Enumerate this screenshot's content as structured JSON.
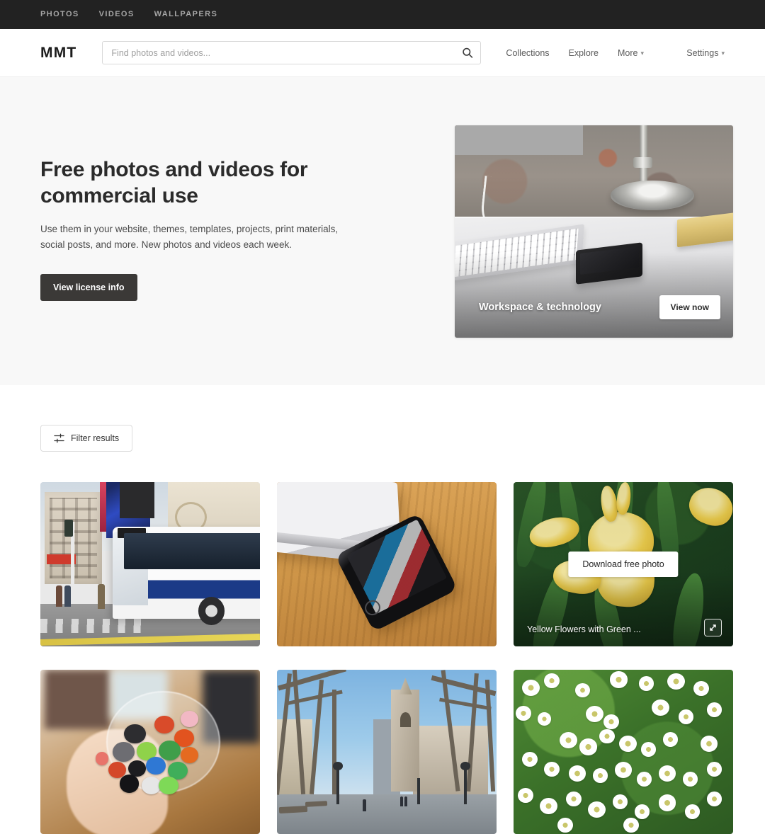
{
  "topbar": {
    "links": [
      {
        "label": "PHOTOS"
      },
      {
        "label": "VIDEOS"
      },
      {
        "label": "WALLPAPERS"
      }
    ]
  },
  "header": {
    "logo": "MMT",
    "search": {
      "placeholder": "Find photos and videos...",
      "value": "",
      "icon": "search-icon"
    },
    "nav": [
      {
        "label": "Collections",
        "has_chevron": false
      },
      {
        "label": "Explore",
        "has_chevron": false
      },
      {
        "label": "More",
        "has_chevron": true
      }
    ],
    "account": {
      "label": "Settings",
      "has_chevron": true
    }
  },
  "hero": {
    "title": "Free photos and videos for commercial use",
    "subtitle": "Use them in your website, themes, templates, projects, print materials, social posts, and more. New photos and videos each week.",
    "cta_label": "View license info",
    "card": {
      "title": "Workspace & technology",
      "button_label": "View now",
      "image_alt": "Desk with keyboard, smartphone, lamp base and yellow notepad"
    }
  },
  "results": {
    "filter_label": "Filter results",
    "filter_icon": "tune-icon",
    "photos": [
      {
        "alt": "New York City Bus 6820 at a street intersection",
        "caption": "",
        "hovered": false
      },
      {
        "alt": "Laptop and smartphone on a wooden desk",
        "caption": "",
        "hovered": false
      },
      {
        "alt": "Yellow flowers with green leaves",
        "caption": "Yellow Flowers with Green ...",
        "hovered": true,
        "download_label": "Download free photo",
        "expand_icon": "expand-icon"
      },
      {
        "alt": "Hand holding a clear cup full of colorful markers",
        "caption": "",
        "hovered": false
      },
      {
        "alt": "Tree lined plaza with a stone clock tower under blue sky",
        "caption": "",
        "hovered": false
      },
      {
        "alt": "White alyssum flowers with green foliage",
        "caption": "",
        "hovered": false
      }
    ]
  },
  "colors": {
    "topbar_bg": "#222222",
    "hero_bg": "#f8f8f8",
    "page_bg": "#ffffff",
    "dark_button": "#3b3937",
    "text_primary": "#2b2b2b",
    "text_muted": "#5a5a5a"
  }
}
